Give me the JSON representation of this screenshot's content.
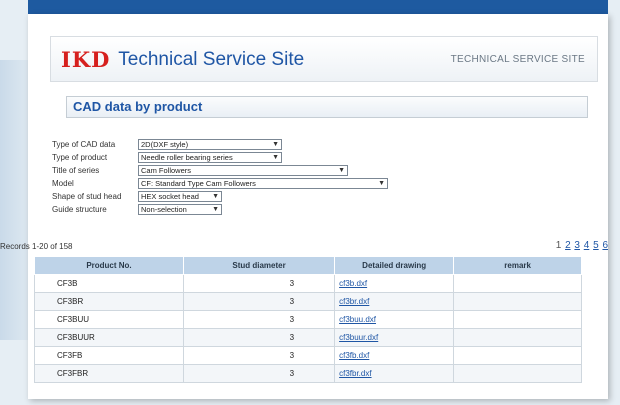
{
  "brand": {
    "logo": "IKD",
    "title": "Technical Service Site",
    "tagline": "TECHNICAL SERVICE SITE"
  },
  "section": {
    "title": "CAD data by product"
  },
  "filters": [
    {
      "label": "Type of CAD data",
      "value": "2D(DXF style)"
    },
    {
      "label": "Type of product",
      "value": "Needle roller bearing series"
    },
    {
      "label": "Title of series",
      "value": "Cam Followers"
    },
    {
      "label": "Model",
      "value": "CF: Standard Type Cam Followers"
    },
    {
      "label": "Shape of stud head",
      "value": "HEX socket head"
    },
    {
      "label": "Guide structure",
      "value": "Non-selection"
    }
  ],
  "records": "Records 1-20 of 158",
  "pager": {
    "current": "1",
    "pages": [
      "2",
      "3",
      "4",
      "5",
      "6"
    ]
  },
  "table": {
    "headers": [
      "Product No.",
      "Stud diameter",
      "Detailed drawing",
      "remark"
    ],
    "rows": [
      {
        "product": "CF3B",
        "stud": "3",
        "drawing": "cf3b.dxf",
        "remark": ""
      },
      {
        "product": "CF3BR",
        "stud": "3",
        "drawing": "cf3br.dxf",
        "remark": ""
      },
      {
        "product": "CF3BUU",
        "stud": "3",
        "drawing": "cf3buu.dxf",
        "remark": ""
      },
      {
        "product": "CF3BUUR",
        "stud": "3",
        "drawing": "cf3buur.dxf",
        "remark": ""
      },
      {
        "product": "CF3FB",
        "stud": "3",
        "drawing": "cf3fb.dxf",
        "remark": ""
      },
      {
        "product": "CF3FBR",
        "stud": "3",
        "drawing": "cf3fbr.dxf",
        "remark": ""
      }
    ]
  }
}
